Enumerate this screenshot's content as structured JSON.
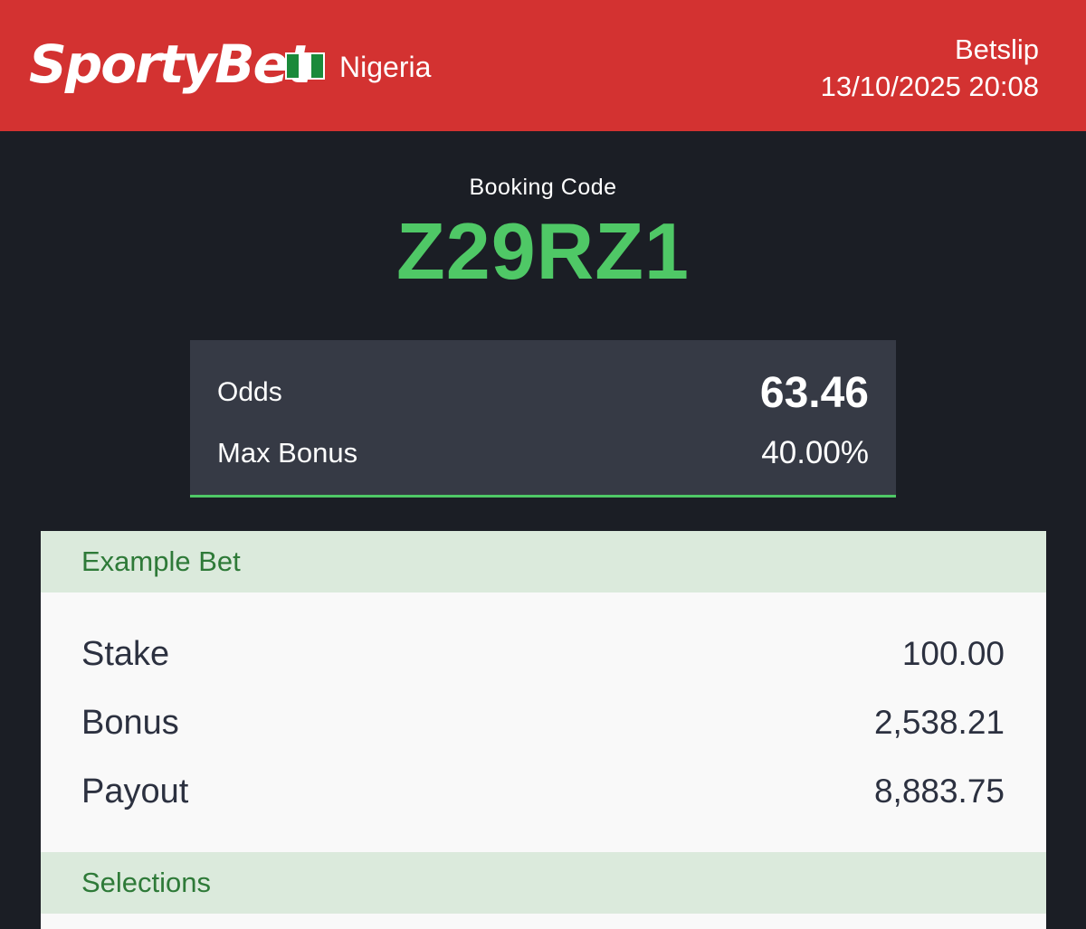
{
  "header": {
    "brand": "SportyBet",
    "country": "Nigeria",
    "page_label": "Betslip",
    "datetime": "13/10/2025 20:08"
  },
  "booking": {
    "label": "Booking Code",
    "code": "Z29RZ1"
  },
  "odds_card": {
    "odds_label": "Odds",
    "odds_value": "63.46",
    "max_bonus_label": "Max Bonus",
    "max_bonus_value": "40.00%"
  },
  "example_bet": {
    "title": "Example Bet",
    "rows": [
      {
        "label": "Stake",
        "value": "100.00"
      },
      {
        "label": "Bonus",
        "value": "2,538.21"
      },
      {
        "label": "Payout",
        "value": "8,883.75"
      }
    ]
  },
  "selections": {
    "title": "Selections"
  },
  "colors": {
    "header_bg": "#d33231",
    "page_bg": "#1b1e25",
    "accent_green": "#4fc866",
    "card_bg": "#363a45",
    "section_bg": "#dbeadc",
    "section_text": "#2e7a38"
  }
}
